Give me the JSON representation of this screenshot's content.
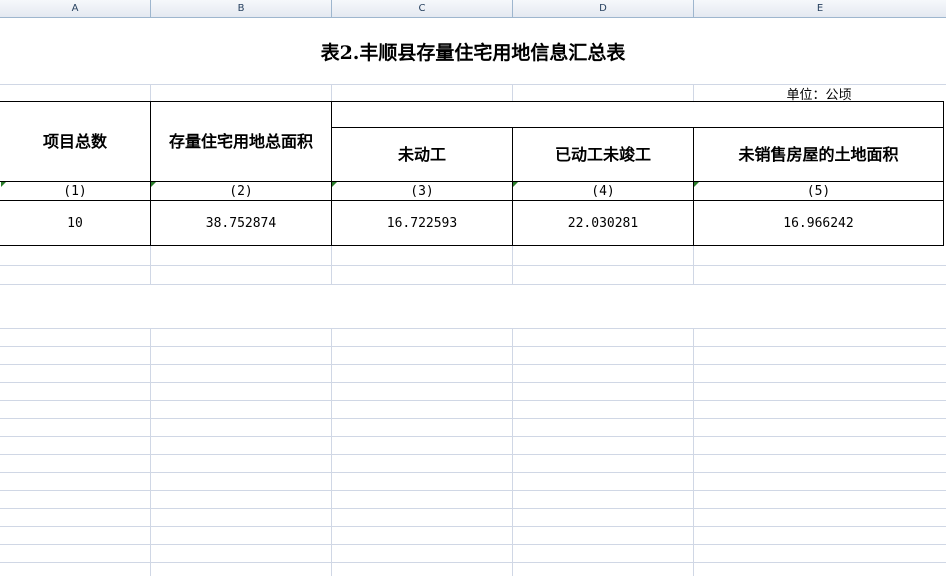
{
  "columns": [
    "A",
    "B",
    "C",
    "D",
    "E"
  ],
  "title": "表2.丰顺县存量住宅用地信息汇总表",
  "unit": "单位：公顷",
  "headers": {
    "project_count": "项目总数",
    "total_area": "存量住宅用地总面积",
    "not_started": "未动工",
    "started_unfinished": "已动工未竣工",
    "unsold_land": "未销售房屋的土地面积"
  },
  "index_row": [
    "(1)",
    "(2)",
    "(3)",
    "(4)",
    "(5)"
  ],
  "data_row": [
    "10",
    "38.752874",
    "16.722593",
    "22.030281",
    "16.966242"
  ]
}
